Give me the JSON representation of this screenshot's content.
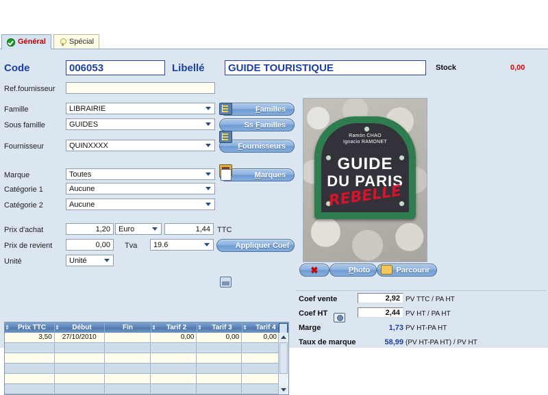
{
  "tabs": [
    {
      "label": "Général",
      "icon": "check-circle-icon",
      "active": true
    },
    {
      "label": "Spécial",
      "icon": "lightbulb-icon",
      "active": false
    }
  ],
  "header": {
    "code_label": "Code",
    "code_value": "006053",
    "libelle_label": "Libellé",
    "libelle_value": "GUIDE TOURISTIQUE",
    "stock_label": "Stock",
    "stock_value": "0,00",
    "stock_color": "#e00000"
  },
  "fields": {
    "ref_fournisseur_label": "Ref.fournisseur",
    "ref_fournisseur_value": "",
    "famille_label": "Famille",
    "famille_value": "LIBRAIRIE",
    "sous_famille_label": "Sous famille",
    "sous_famille_value": "GUIDES",
    "fournisseur_label": "Fournisseur",
    "fournisseur_value": "QUINXXXX",
    "marque_label": "Marque",
    "marque_value": "Toutes",
    "categorie1_label": "Catégorie 1",
    "categorie1_value": "Aucune",
    "categorie2_label": "Catégorie 2",
    "categorie2_value": "Aucune",
    "prix_achat_label": "Prix d'achat",
    "prix_achat_value": "1,20",
    "devise_value": "Euro",
    "prix_achat_ttc_value": "1,44",
    "ttc_label": "TTC",
    "prix_revient_label": "Prix de revient",
    "prix_revient_value": "0,00",
    "tva_label": "Tva",
    "tva_value": "19.6",
    "unite_label": "Unité",
    "unite_value": "Unité"
  },
  "buttons": {
    "familles": "Familles",
    "familles_mnemonic": "F",
    "ss_familles_pre": "Ss ",
    "ss_familles": "Familles",
    "ss_familles_mnemonic": "F",
    "fournisseurs": "Fournisseurs",
    "fournisseurs_mnemonic": "F",
    "marques": "Marques",
    "marques_mnemonic": "M",
    "appliquer_coef": "Appliquer Coef",
    "photo": "Photo",
    "photo_mnemonic": "P",
    "parcourir": "Parcourir",
    "delete_photo": "✖"
  },
  "photo": {
    "alt": "Guide du Paris Rebelle book cover",
    "authors_line1": "Ramón CHAO",
    "authors_line2": "Ignacio RAMONET",
    "title_line1": "GUIDE",
    "title_line2": "DU PARIS",
    "title_line3": "REBELLE"
  },
  "grid": {
    "columns": [
      "Prix TTC",
      "Début",
      "Fin",
      "Tarif 2",
      "Tarif 3",
      "Tarif 4"
    ],
    "rows": [
      {
        "prix_ttc": "3,50",
        "debut": "27/10/2010",
        "fin": "",
        "tarif2": "0,00",
        "tarif3": "0,00",
        "tarif4": "0,00"
      },
      {
        "prix_ttc": "",
        "debut": "",
        "fin": "",
        "tarif2": "",
        "tarif3": "",
        "tarif4": ""
      },
      {
        "prix_ttc": "",
        "debut": "",
        "fin": "",
        "tarif2": "",
        "tarif3": "",
        "tarif4": ""
      },
      {
        "prix_ttc": "",
        "debut": "",
        "fin": "",
        "tarif2": "",
        "tarif3": "",
        "tarif4": ""
      },
      {
        "prix_ttc": "",
        "debut": "",
        "fin": "",
        "tarif2": "",
        "tarif3": "",
        "tarif4": ""
      },
      {
        "prix_ttc": "",
        "debut": "",
        "fin": "",
        "tarif2": "",
        "tarif3": "",
        "tarif4": ""
      }
    ]
  },
  "coef": {
    "coef_vente_label": "Coef vente",
    "coef_vente_value": "2,92",
    "coef_vente_note": "PV TTC / PA HT",
    "coef_ht_label": "Coef HT",
    "coef_ht_value": "2,44",
    "coef_ht_note": "PV HT / PA HT",
    "marge_label": "Marge",
    "marge_value": "1,73",
    "marge_note": "PV HT-PA HT",
    "taux_marque_label": "Taux de marque",
    "taux_marque_value": "58,99",
    "taux_marque_note": "(PV HT-PA HT) / PV HT"
  },
  "colors": {
    "panel_bg": "#dce6f0",
    "accent_blue": "#1b3fa0",
    "tab_active_text": "#c00000",
    "button_blue": "#6f9bd2"
  }
}
